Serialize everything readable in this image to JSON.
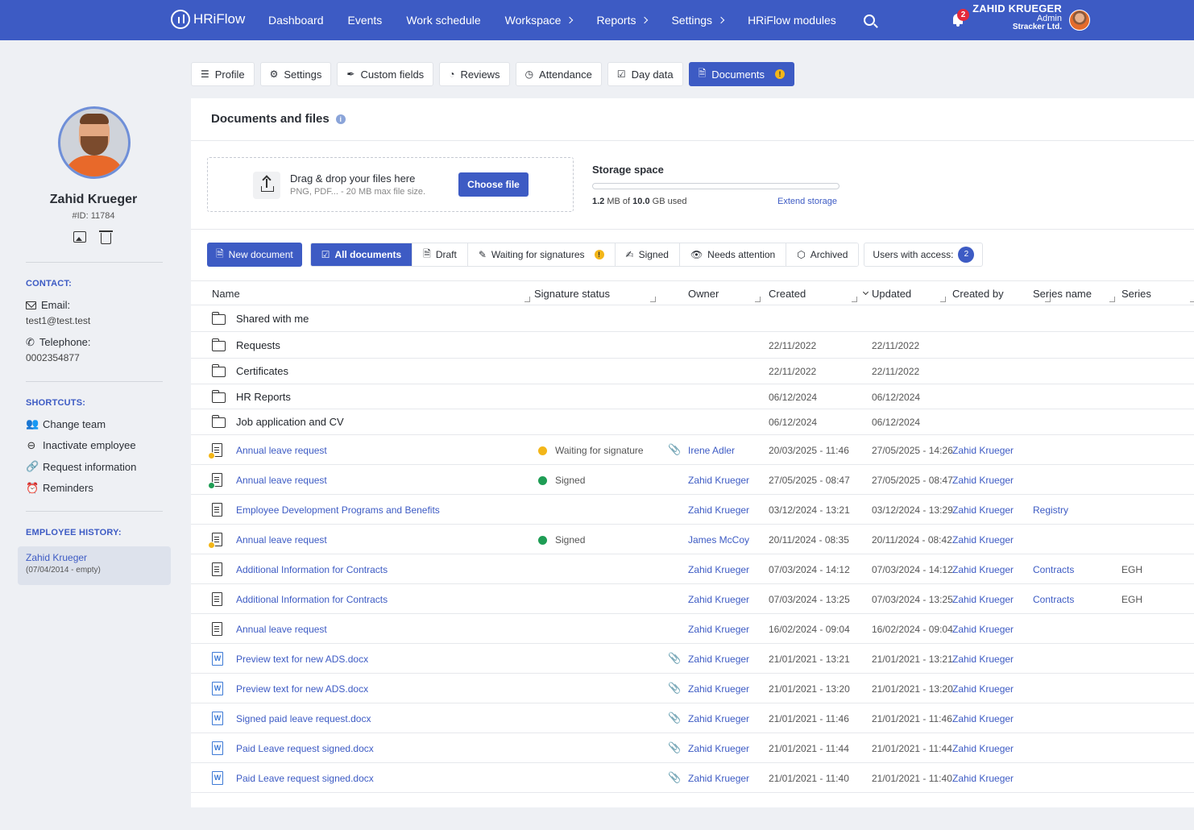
{
  "app": {
    "logo": "HRiFlow"
  },
  "nav": {
    "items": [
      {
        "label": "Dashboard",
        "has_chevron": false
      },
      {
        "label": "Events",
        "has_chevron": false
      },
      {
        "label": "Work schedule",
        "has_chevron": false
      },
      {
        "label": "Workspace",
        "has_chevron": true
      },
      {
        "label": "Reports",
        "has_chevron": true
      },
      {
        "label": "Settings",
        "has_chevron": true
      },
      {
        "label": "HRiFlow modules",
        "has_chevron": false
      }
    ],
    "notification_count": "2",
    "user": {
      "name": "ZAHID KRUEGER",
      "role": "Admin",
      "company": "Stracker Ltd."
    }
  },
  "profile": {
    "name": "Zahid Krueger",
    "id": "#ID: 11784",
    "contact_title": "CONTACT:",
    "email_label": "Email:",
    "email": "test1@test.test",
    "phone_label": "Telephone:",
    "phone": "0002354877",
    "shortcuts_title": "SHORTCUTS:",
    "shortcuts": [
      {
        "label": "Change team",
        "icon": "team-icon"
      },
      {
        "label": "Inactivate employee",
        "icon": "minus-circle-icon"
      },
      {
        "label": "Request information",
        "icon": "link-icon"
      },
      {
        "label": "Reminders",
        "icon": "alarm-icon"
      }
    ],
    "history_title": "EMPLOYEE HISTORY:",
    "history": {
      "name": "Zahid Krueger",
      "range": "(07/04/2014 - empty)"
    }
  },
  "tabs": [
    {
      "label": "Profile",
      "icon": "profile-icon",
      "active": false
    },
    {
      "label": "Settings",
      "icon": "gear-icon",
      "active": false
    },
    {
      "label": "Custom fields",
      "icon": "tag-icon",
      "active": false
    },
    {
      "label": "Reviews",
      "icon": "pie-icon",
      "active": false
    },
    {
      "label": "Attendance",
      "icon": "clock-icon",
      "active": false
    },
    {
      "label": "Day data",
      "icon": "checklist-icon",
      "active": false
    },
    {
      "label": "Documents",
      "icon": "document-icon",
      "active": true,
      "warning": "!"
    }
  ],
  "documents": {
    "title": "Documents and files",
    "upload": {
      "title": "Drag & drop your files here",
      "subtitle": "PNG, PDF... - 20 MB max file size.",
      "button": "Choose file"
    },
    "storage": {
      "title": "Storage space",
      "used_value": "1.2",
      "used_unit": "MB of",
      "total_value": "10.0",
      "total_unit": "GB used",
      "extend": "Extend storage",
      "fraction_used": 0.00012
    },
    "toolbar": {
      "new_document": "New document",
      "filters": [
        {
          "label": "All documents",
          "icon": "checkbox-icon",
          "active": true
        },
        {
          "label": "Draft",
          "icon": "document-icon",
          "active": false
        },
        {
          "label": "Waiting for signatures",
          "icon": "pen-icon",
          "active": false,
          "warning": "!"
        },
        {
          "label": "Signed",
          "icon": "signature-icon",
          "active": false
        },
        {
          "label": "Needs attention",
          "icon": "eye-icon",
          "active": false
        },
        {
          "label": "Archived",
          "icon": "box-icon",
          "active": false
        }
      ],
      "users_access_label": "Users with access:",
      "users_access_count": "2"
    },
    "columns": [
      "Name",
      "Signature status",
      "Owner",
      "Created",
      "Updated",
      "Created by",
      "Series name",
      "Series"
    ],
    "folders": [
      {
        "name": "Shared with me",
        "created": "",
        "updated": "",
        "shared": true
      },
      {
        "name": "Requests",
        "created": "22/11/2022",
        "updated": "22/11/2022"
      },
      {
        "name": "Certificates",
        "created": "22/11/2022",
        "updated": "22/11/2022"
      },
      {
        "name": "HR Reports",
        "created": "06/12/2024",
        "updated": "06/12/2024"
      },
      {
        "name": "Job application and CV",
        "created": "06/12/2024",
        "updated": "06/12/2024"
      }
    ],
    "files": [
      {
        "name": "Annual leave request",
        "type": "doc",
        "badge": "waiting",
        "status": "Waiting for signature",
        "status_color": "#f3b619",
        "attachment": true,
        "owner": "Irene Adler",
        "created": "20/03/2025 - 11:46",
        "updated": "27/05/2025 - 14:26",
        "created_by": "Zahid Krueger",
        "series_name": "",
        "series": ""
      },
      {
        "name": "Annual leave request",
        "type": "doc",
        "badge": "signed",
        "status": "Signed",
        "status_color": "#1f9d55",
        "attachment": false,
        "owner": "Zahid Krueger",
        "created": "27/05/2025 - 08:47",
        "updated": "27/05/2025 - 08:47",
        "created_by": "Zahid Krueger",
        "series_name": "",
        "series": ""
      },
      {
        "name": "Employee Development Programs and Benefits",
        "type": "doc",
        "badge": "",
        "status": "",
        "status_color": "",
        "attachment": false,
        "owner": "Zahid Krueger",
        "created": "03/12/2024 - 13:21",
        "updated": "03/12/2024 - 13:29",
        "created_by": "Zahid Krueger",
        "series_name": "Registry",
        "series": ""
      },
      {
        "name": "Annual leave request",
        "type": "doc",
        "badge": "waiting",
        "status": "Signed",
        "status_color": "#1f9d55",
        "attachment": false,
        "owner": "James McCoy",
        "created": "20/11/2024 - 08:35",
        "updated": "20/11/2024 - 08:42",
        "created_by": "Zahid Krueger",
        "series_name": "",
        "series": ""
      },
      {
        "name": "Additional Information for Contracts",
        "type": "doc",
        "badge": "",
        "status": "",
        "status_color": "",
        "attachment": false,
        "owner": "Zahid Krueger",
        "created": "07/03/2024 - 14:12",
        "updated": "07/03/2024 - 14:12",
        "created_by": "Zahid Krueger",
        "series_name": "Contracts",
        "series": "EGH"
      },
      {
        "name": "Additional Information for Contracts",
        "type": "doc",
        "badge": "",
        "status": "",
        "status_color": "",
        "attachment": false,
        "owner": "Zahid Krueger",
        "created": "07/03/2024 - 13:25",
        "updated": "07/03/2024 - 13:25",
        "created_by": "Zahid Krueger",
        "series_name": "Contracts",
        "series": "EGH"
      },
      {
        "name": "Annual leave request",
        "type": "doc",
        "badge": "",
        "status": "",
        "status_color": "",
        "attachment": false,
        "owner": "Zahid Krueger",
        "created": "16/02/2024 - 09:04",
        "updated": "16/02/2024 - 09:04",
        "created_by": "Zahid Krueger",
        "series_name": "",
        "series": ""
      },
      {
        "name": "Preview text for new ADS.docx",
        "type": "word",
        "badge": "",
        "status": "",
        "status_color": "",
        "attachment": true,
        "owner": "Zahid Krueger",
        "created": "21/01/2021 - 13:21",
        "updated": "21/01/2021 - 13:21",
        "created_by": "Zahid Krueger",
        "series_name": "",
        "series": ""
      },
      {
        "name": "Preview text for new ADS.docx",
        "type": "word",
        "badge": "",
        "status": "",
        "status_color": "",
        "attachment": true,
        "owner": "Zahid Krueger",
        "created": "21/01/2021 - 13:20",
        "updated": "21/01/2021 - 13:20",
        "created_by": "Zahid Krueger",
        "series_name": "",
        "series": ""
      },
      {
        "name": "Signed paid leave request.docx",
        "type": "word",
        "badge": "",
        "status": "",
        "status_color": "",
        "attachment": true,
        "owner": "Zahid Krueger",
        "created": "21/01/2021 - 11:46",
        "updated": "21/01/2021 - 11:46",
        "created_by": "Zahid Krueger",
        "series_name": "",
        "series": ""
      },
      {
        "name": "Paid Leave request signed.docx",
        "type": "word",
        "badge": "",
        "status": "",
        "status_color": "",
        "attachment": true,
        "owner": "Zahid Krueger",
        "created": "21/01/2021 - 11:44",
        "updated": "21/01/2021 - 11:44",
        "created_by": "Zahid Krueger",
        "series_name": "",
        "series": ""
      },
      {
        "name": "Paid Leave request signed.docx",
        "type": "word",
        "badge": "",
        "status": "",
        "status_color": "",
        "attachment": true,
        "owner": "Zahid Krueger",
        "created": "21/01/2021 - 11:40",
        "updated": "21/01/2021 - 11:40",
        "created_by": "Zahid Krueger",
        "series_name": "",
        "series": ""
      }
    ],
    "colors": {
      "accent": "#3d5bc4",
      "waiting": "#f3b619",
      "signed": "#1f9d55"
    }
  }
}
